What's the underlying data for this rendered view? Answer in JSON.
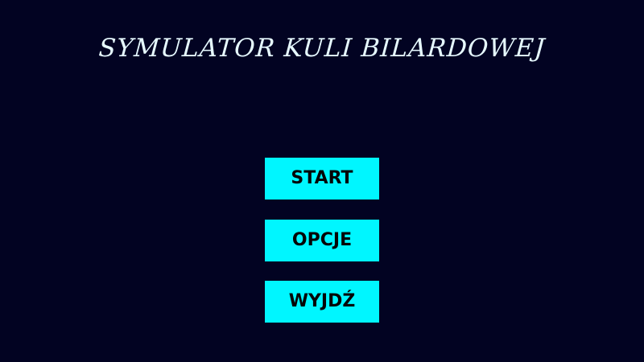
{
  "title": "SYMULATOR KULI BILARDOWEJ",
  "menu": {
    "start_label": "START",
    "options_label": "OPCJE",
    "exit_label": "WYJDŹ"
  },
  "colors": {
    "background": "#020322",
    "title": "#e6f9ff",
    "button_background": "#00f6ff",
    "button_text": "#050505"
  }
}
